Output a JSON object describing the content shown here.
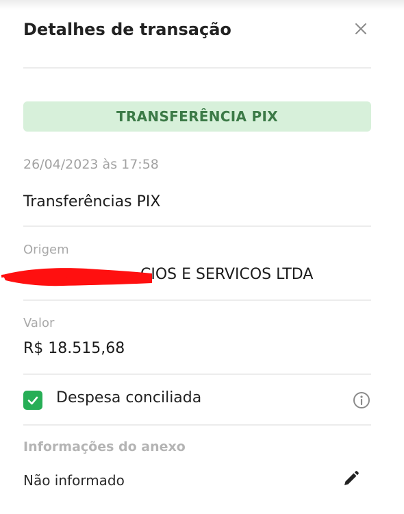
{
  "modal": {
    "title": "Detalhes de transação",
    "close_icon": "close-icon"
  },
  "transaction": {
    "type_badge": "TRANSFERÊNCIA PIX",
    "datetime": "26/04/2023 às 17:58",
    "description": "Transferências PIX",
    "origin_label": "Origem",
    "origin_value": "CIOS E SERVICOS LTDA",
    "amount_label": "Valor",
    "amount_value": "R$ 18.515,68"
  },
  "reconciliation": {
    "checked": true,
    "label": "Despesa conciliada",
    "info_icon": "info-icon"
  },
  "attachment": {
    "title": "Informações do anexo",
    "value": "Não informado",
    "edit_icon": "pencil-icon"
  },
  "colors": {
    "badge_bg": "#d7f0da",
    "badge_text": "#3c7a47",
    "checkbox": "#27ae56",
    "redaction": "#ff0000"
  }
}
